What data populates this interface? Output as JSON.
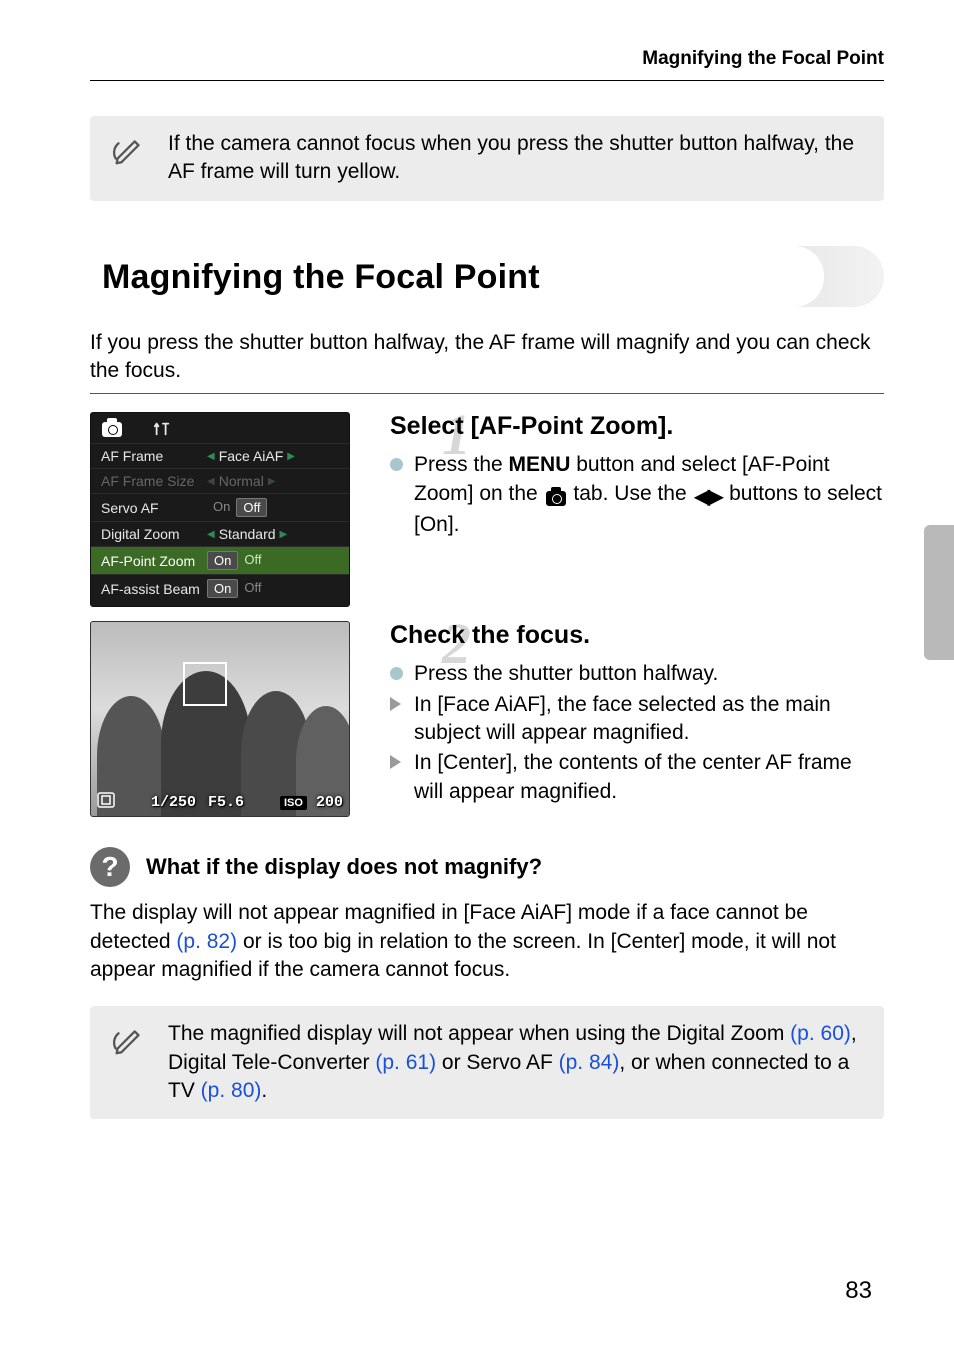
{
  "running_head": "Magnifying the Focal Point",
  "top_note": "If the camera cannot focus when you press the shutter button halfway, the AF frame will turn yellow.",
  "heading": "Magnifying the Focal Point",
  "intro": "If you press the shutter button halfway, the AF frame will magnify and you can check the focus.",
  "menu": {
    "rows": [
      {
        "label": "AF Frame",
        "value": "Face AiAF",
        "type": "nav",
        "dim": false
      },
      {
        "label": "AF Frame Size",
        "value": "Normal",
        "type": "nav",
        "dim": true
      },
      {
        "label": "Servo AF",
        "value_on": "On",
        "value_off": "Off",
        "type": "onoff",
        "selected": "Off",
        "dim": false
      },
      {
        "label": "Digital Zoom",
        "value": "Standard",
        "type": "nav",
        "dim": false
      },
      {
        "label": "AF-Point Zoom",
        "value_on": "On",
        "value_off": "Off",
        "type": "onoff",
        "selected": "On",
        "dim": false,
        "highlight": true
      },
      {
        "label": "AF-assist Beam",
        "value_on": "On",
        "value_off": "Off",
        "type": "onoff",
        "selected": "On",
        "dim": false
      }
    ]
  },
  "step1": {
    "num": "1",
    "title": "Select [AF-Point Zoom].",
    "line_a": "Press the ",
    "menu_word": "MENU",
    "line_b": " button and select [AF-Point Zoom] on the ",
    "line_c": " tab. Use the ",
    "line_d": " buttons to select [On]."
  },
  "photo": {
    "shutter": "1/250",
    "aperture": "F5.6",
    "iso_prefix": "ISO",
    "iso_val": "200"
  },
  "step2": {
    "num": "2",
    "title": "Check the focus.",
    "b1": "Press the shutter button halfway.",
    "b2": "In [Face AiAF], the face selected as the main subject will appear magnified.",
    "b3": "In [Center], the contents of the center AF frame will appear magnified."
  },
  "question": {
    "title": "What if the display does not magnify?",
    "body_a": "The display will not appear magnified in [Face AiAF] mode if a face cannot be detected ",
    "link1": "(p. 82)",
    "body_b": " or is too big in relation to the screen. In [Center] mode, it will not appear magnified if the camera cannot focus."
  },
  "bottom_note": {
    "a": "The magnified display will not appear when using the Digital Zoom ",
    "l1": "(p. 60)",
    "b": ", Digital Tele-Converter ",
    "l2": "(p. 61)",
    "c": " or Servo AF ",
    "l3": "(p. 84)",
    "d": ", or when connected to a TV ",
    "l4": "(p. 80)",
    "e": "."
  },
  "page_number": "83"
}
